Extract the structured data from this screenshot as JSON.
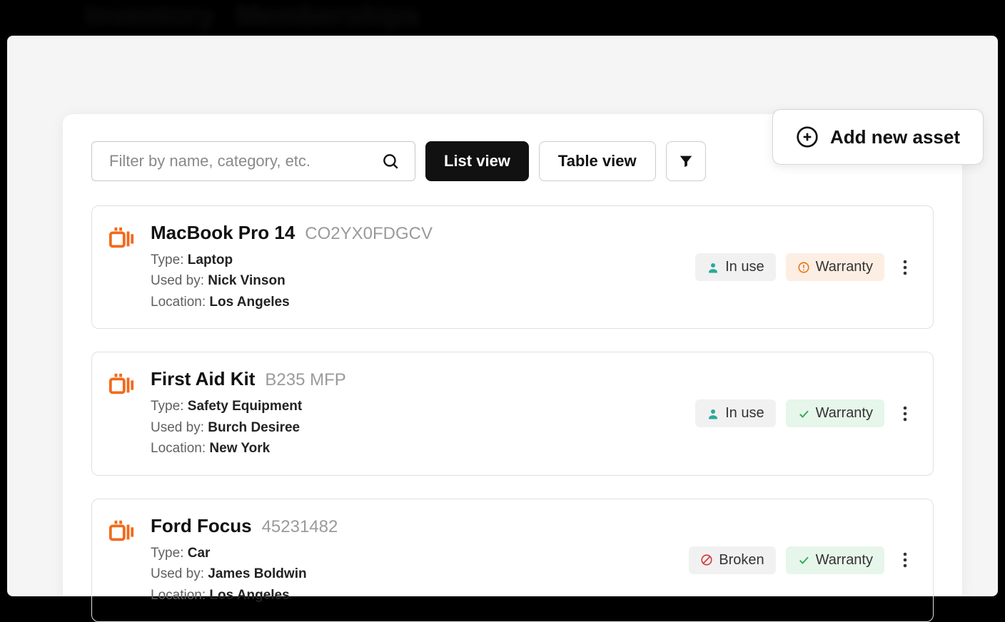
{
  "blur_tabs": [
    "Inventory",
    "Memberships"
  ],
  "toolbar": {
    "filter_placeholder": "Filter by name, category, etc.",
    "list_view": "List view",
    "table_view": "Table view"
  },
  "add_asset_label": "Add new asset",
  "meta_labels": {
    "type": "Type:",
    "used_by": "Used by:",
    "location": "Location:"
  },
  "assets": [
    {
      "name": "MacBook Pro 14",
      "serial": "CO2YX0FDGCV",
      "type": "Laptop",
      "used_by": "Nick Vinson",
      "location": "Los Angeles",
      "status": {
        "label": "In use",
        "kind": "inuse"
      },
      "warranty": {
        "label": "Warranty",
        "kind": "warning"
      }
    },
    {
      "name": "First Aid Kit",
      "serial": "B235 MFP",
      "type": "Safety Equipment",
      "used_by": "Burch Desiree",
      "location": "New York",
      "status": {
        "label": "In use",
        "kind": "inuse"
      },
      "warranty": {
        "label": "Warranty",
        "kind": "ok"
      }
    },
    {
      "name": "Ford Focus",
      "serial": "45231482",
      "type": "Car",
      "used_by": "James Boldwin",
      "location": "Los Angeles",
      "status": {
        "label": "Broken",
        "kind": "broken"
      },
      "warranty": {
        "label": "Warranty",
        "kind": "ok"
      }
    }
  ]
}
